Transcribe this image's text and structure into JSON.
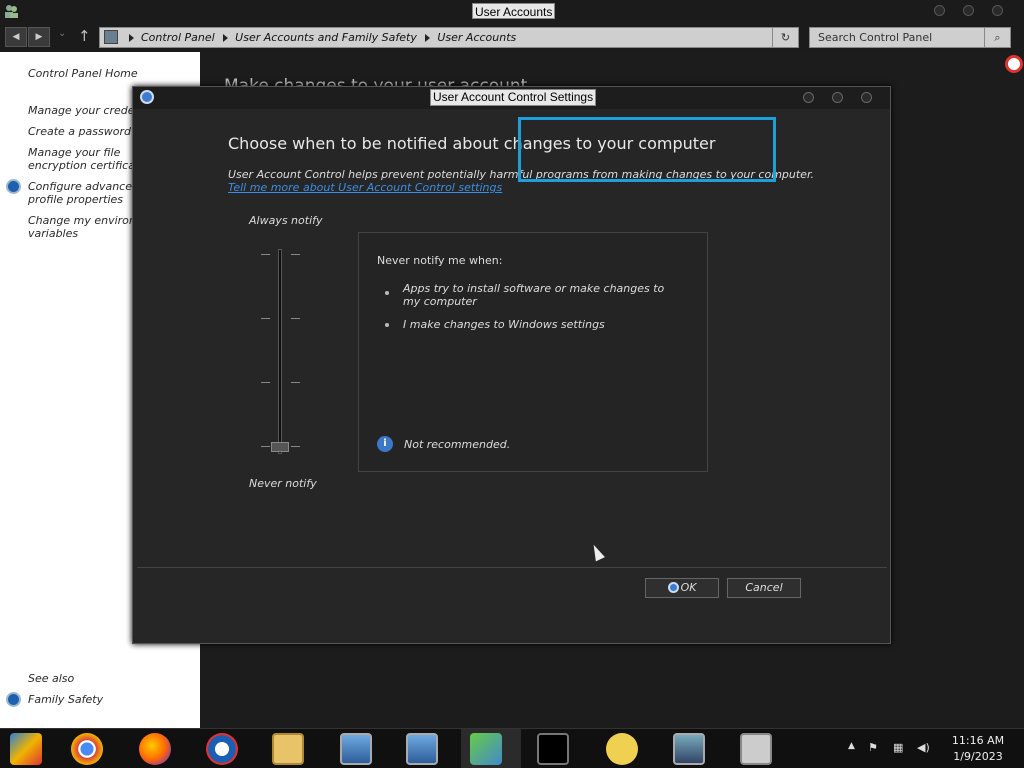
{
  "window": {
    "title": "User Accounts"
  },
  "address": {
    "breadcrumb": [
      "Control Panel",
      "User Accounts and Family Safety",
      "User Accounts"
    ],
    "search_placeholder": "Search Control Panel"
  },
  "left_pane": {
    "home": "Control Panel Home",
    "links": [
      "Manage your credentials",
      "Create a password reset disk",
      "Manage your file encryption certificates",
      "Configure advanced user profile properties",
      "Change my environment variables"
    ],
    "see_also": "See also",
    "family_safety": "Family Safety"
  },
  "main": {
    "title": "Make changes to your user account"
  },
  "dialog": {
    "title": "User Account Control Settings",
    "heading": "Choose when to be notified about changes to your computer",
    "description": "User Account Control helps prevent potentially harmful programs from making changes to your computer.",
    "learn_more": "Tell me more about User Account Control settings",
    "slider_top": "Always notify",
    "slider_bottom": "Never notify",
    "slider_level": 0,
    "slider_levels": 4,
    "info": {
      "heading": "Never notify me when:",
      "items": [
        "Apps try to install software or make changes to my computer",
        "I make changes to Windows settings"
      ],
      "note": "Not recommended."
    },
    "ok_label": "OK",
    "cancel_label": "Cancel"
  },
  "taskbar": {
    "time": "11:16 AM",
    "date": "1/9/2023",
    "icons": [
      "control-panel",
      "chrome",
      "firefox",
      "browser",
      "file-explorer",
      "network-computer",
      "network-computer-2",
      "users",
      "command-prompt",
      "help",
      "remote-desktop",
      "settings-panel"
    ]
  }
}
